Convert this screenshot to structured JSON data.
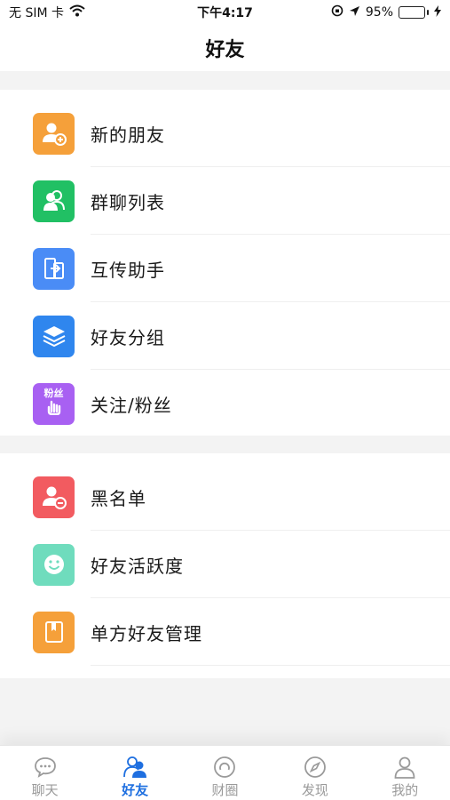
{
  "status_bar": {
    "carrier": "无 SIM 卡",
    "time": "下午4:17",
    "battery_percent": "95%",
    "battery_level": 0.95,
    "icons": [
      "wifi-icon",
      "orientation-lock-icon",
      "location-arrow-icon",
      "battery-icon",
      "charging-bolt-icon"
    ]
  },
  "header": {
    "title": "好友"
  },
  "group1": {
    "items": [
      {
        "label": "新的朋友",
        "icon": "add-user-icon",
        "color": "#f5a03a"
      },
      {
        "label": "群聊列表",
        "icon": "group-users-icon",
        "color": "#21c064"
      },
      {
        "label": "互传助手",
        "icon": "transfer-icon",
        "color": "#4a8cf6"
      },
      {
        "label": "好友分组",
        "icon": "layers-icon",
        "color": "#2f86ee"
      },
      {
        "label": "关注/粉丝",
        "icon": "fans-icon",
        "icon_text": "粉丝",
        "color": "#a860f2"
      }
    ]
  },
  "group2": {
    "items": [
      {
        "label": "黑名单",
        "icon": "remove-user-icon",
        "color": "#f25b60"
      },
      {
        "label": "好友活跃度",
        "icon": "smile-icon",
        "color": "#6fdcbd"
      },
      {
        "label": "单方好友管理",
        "icon": "book-icon",
        "color": "#f5a03a"
      }
    ]
  },
  "tab_bar": {
    "active": "好友",
    "active_color": "#1e6fe0",
    "tabs": [
      {
        "label": "聊天",
        "icon": "chat-bubble-icon"
      },
      {
        "label": "好友",
        "icon": "friends-icon"
      },
      {
        "label": "财圈",
        "icon": "circle-icon"
      },
      {
        "label": "发现",
        "icon": "compass-icon"
      },
      {
        "label": "我的",
        "icon": "person-icon"
      }
    ]
  }
}
